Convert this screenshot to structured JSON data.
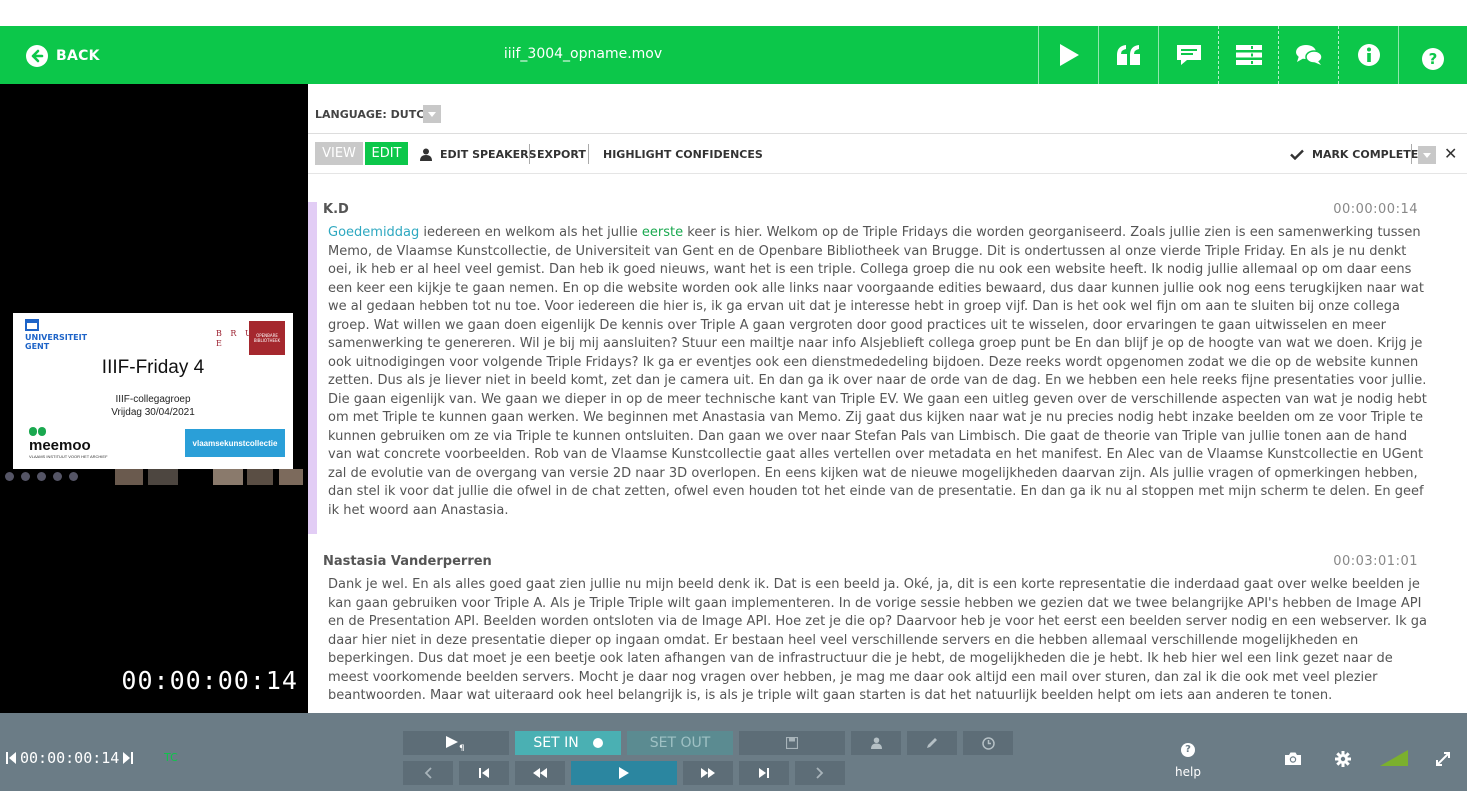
{
  "header": {
    "back_label": "BACK",
    "filename": "iiif_3004_opname.mov",
    "icons": [
      "play-icon",
      "quote-icon",
      "subtitle-icon",
      "layout-icon",
      "comments-icon",
      "info-icon",
      "help-icon"
    ]
  },
  "video": {
    "slide": {
      "university": "UNIVERSITEIT GENT",
      "brugge": "B R U G G E",
      "library": "OPENBARE BIBLIOTHEEK",
      "title": "IIIF-Friday 4",
      "subtitle1": "IIIF-collegagroep",
      "subtitle2": "Vrijdag 30/04/2021",
      "meemoo": "meemoo",
      "meemoo_tag": "VLAAMS INSTITUUT VOOR HET ARCHIEF",
      "vkc": "vlaamsekunstcollectie"
    },
    "timecode": "00:00:00:14"
  },
  "editor": {
    "language_label": "LANGUAGE: DUTCH",
    "toolbar": {
      "view": "VIEW",
      "edit": "EDIT",
      "edit_speakers": "EDIT SPEAKERS",
      "export": "EXPORT",
      "highlight": "HIGHLIGHT CONFIDENCES",
      "mark_complete": "MARK COMPLETE"
    },
    "segments": [
      {
        "speaker": "K.D",
        "time": "00:00:00:14",
        "w1": "Goedemiddag",
        "t1": " iedereen en welkom als het jullie ",
        "w2": "eerste",
        "t2": " keer is hier. Welkom op de Triple Fridays die worden georganiseerd. Zoals jullie zien is een samenwerking tussen Memo, de Vlaamse Kunstcollectie, de Universiteit van Gent en de Openbare Bibliotheek van Brugge. Dit is ondertussen al onze vierde Triple Friday. En als je nu denkt oei, ik heb er al heel veel gemist. Dan heb ik goed nieuws, want het is een triple. Collega groep die nu ook een website heeft. Ik nodig jullie allemaal op om daar eens een keer een kijkje te gaan nemen. En op die website worden ook alle links naar voorgaande edities bewaard, dus daar kunnen jullie ook nog eens terugkijken naar wat we al gedaan hebben tot nu toe. Voor iedereen die hier is, ik ga ervan uit dat je interesse hebt in groep vijf. Dan is het ook wel fijn om aan te sluiten bij onze collega groep. Wat willen we gaan doen eigenlijk De kennis over Triple A gaan vergroten door good practices uit te wisselen, door ervaringen te gaan uitwisselen en meer samenwerking te genereren. Wil je bij mij aansluiten? Stuur een mailtje naar info Alsjeblieft collega groep punt be En dan blijf je op de hoogte van wat we doen. Krijg je ook uitnodigingen voor volgende Triple Fridays? Ik ga er eventjes ook een dienstmededeling bijdoen. Deze reeks wordt opgenomen zodat we die op de website kunnen zetten. Dus als je liever niet in beeld komt, zet dan je camera uit. En dan ga ik over naar de orde van de dag. En we hebben een hele reeks fijne presentaties voor jullie. Die gaan eigenlijk van. We gaan we dieper in op de meer technische kant van Triple EV. We gaan een uitleg geven over de verschillende aspecten van wat je nodig hebt om met Triple te kunnen gaan werken. We beginnen met Anastasia van Memo. Zij gaat dus kijken naar wat je nu precies nodig hebt inzake beelden om ze voor Triple te kunnen gebruiken om ze via Triple te kunnen ontsluiten. Dan gaan we over naar Stefan Pals van Limbisch. Die gaat de theorie van Triple van jullie tonen aan de hand van wat concrete voorbeelden. Rob van de Vlaamse Kunstcollectie gaat alles vertellen over metadata en het manifest. En Alec van de Vlaamse Kunstcollectie en UGent zal de evolutie van de overgang van versie 2D naar 3D overlopen. En eens kijken wat de nieuwe mogelijkheden daarvan zijn. Als jullie vragen of opmerkingen hebben, dan stel ik voor dat jullie die ofwel in de chat zetten, ofwel even houden tot het einde van de presentatie. En dan ga ik nu al stoppen met mijn scherm te delen. En geef ik het woord aan Anastasia."
      },
      {
        "speaker": "Nastasia Vanderperren",
        "time": "00:03:01:01",
        "text": "Dank je wel. En als alles goed gaat zien jullie nu mijn beeld denk ik. Dat is een beeld ja. Oké, ja, dit is een korte representatie die inderdaad gaat over welke beelden je kan gaan gebruiken voor Triple A. Als je Triple Triple wilt gaan implementeren. In de vorige sessie hebben we gezien dat we twee belangrijke API's hebben de Image API en de Presentation API. Beelden worden ontsloten via de Image API. Hoe zet je die op? Daarvoor heb je voor het eerst een beelden server nodig en een webserver. Ik ga daar hier niet in deze presentatie dieper op ingaan omdat. Er bestaan heel veel verschillende servers en die hebben allemaal verschillende mogelijkheden en beperkingen. Dus dat moet je een beetje ook laten afhangen van de infrastructuur die je hebt, de mogelijkheden die je hebt. Ik heb hier wel een link gezet naar de meest voorkomende beelden servers. Mocht je daar nog vragen over hebben, je mag me daar ook altijd een mail over sturen, dan zal ik die ook met veel plezier beantwoorden. Maar wat uiteraard ook heel belangrijk is, is als je triple wilt gaan starten is dat het natuurlijk beelden helpt om iets aan anderen te tonen."
      }
    ]
  },
  "controls": {
    "timecode": "00:00:00:14",
    "tc_label": "TC",
    "set_in": "SET IN",
    "set_out": "SET OUT",
    "help": "help"
  }
}
